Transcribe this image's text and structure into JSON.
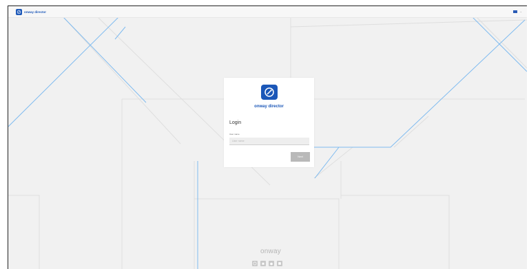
{
  "header": {
    "brand_name": "onway director",
    "brand_icon": "onway-logo-icon",
    "language_icon": "flag-icon"
  },
  "login_card": {
    "app_title": "onway director",
    "heading": "Login",
    "username_label": "User name",
    "username_placeholder": "User name",
    "username_value": "",
    "next_button": "Next"
  },
  "footer": {
    "logo_text": "onway",
    "store_icons": [
      "globe-icon",
      "android-icon",
      "apple-icon",
      "windows-icon"
    ]
  },
  "colors": {
    "brand_blue": "#1b57b8",
    "background": "#f1f1f1",
    "decor_line_blue": "#6fb3f0",
    "decor_line_grey": "#dcdcdc"
  }
}
